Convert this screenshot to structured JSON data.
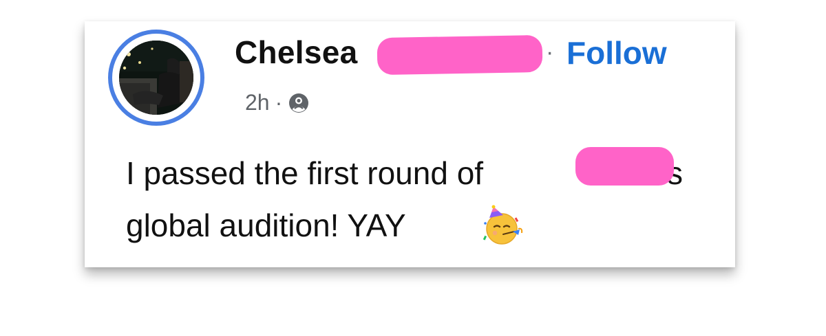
{
  "post": {
    "author": {
      "name": "Chelsea"
    },
    "separator": "·",
    "follow_label": "Follow",
    "timestamp": "2h",
    "meta_separator": "·",
    "audience_icon": "friends-icon",
    "text_line1": "I passed the first round of",
    "text_line1_trailing": "s",
    "text_line2": "global audition! YAY",
    "emoji": "partying-face-emoji"
  },
  "colors": {
    "follow": "#1a6fd6",
    "avatar_ring": "#4a7fe3",
    "redaction": "#ff63c8",
    "meta_text": "#5f6368"
  }
}
